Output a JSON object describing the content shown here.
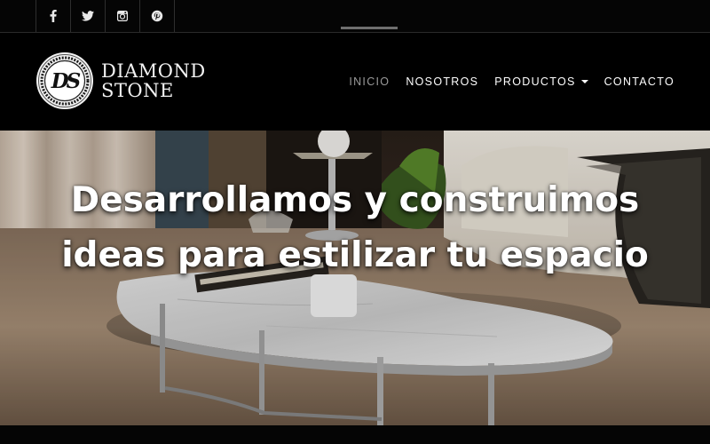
{
  "social": {
    "items": [
      {
        "icon": "facebook-icon"
      },
      {
        "icon": "twitter-icon"
      },
      {
        "icon": "instagram-icon"
      },
      {
        "icon": "pinterest-icon"
      }
    ]
  },
  "brand": {
    "logo_letters": "DS",
    "line1": "DIAMOND",
    "line2": "STONE"
  },
  "nav": {
    "inicio": "INICIO",
    "nosotros": "NOSOTROS",
    "productos": "PRODUCTOS",
    "contacto": "CONTACTO"
  },
  "hero": {
    "line1": "Desarrollamos y construimos",
    "line2": "ideas para estilizar tu espacio"
  },
  "colors": {
    "background": "#000000",
    "text": "#ffffff",
    "active_nav": "#9a9a9a"
  }
}
